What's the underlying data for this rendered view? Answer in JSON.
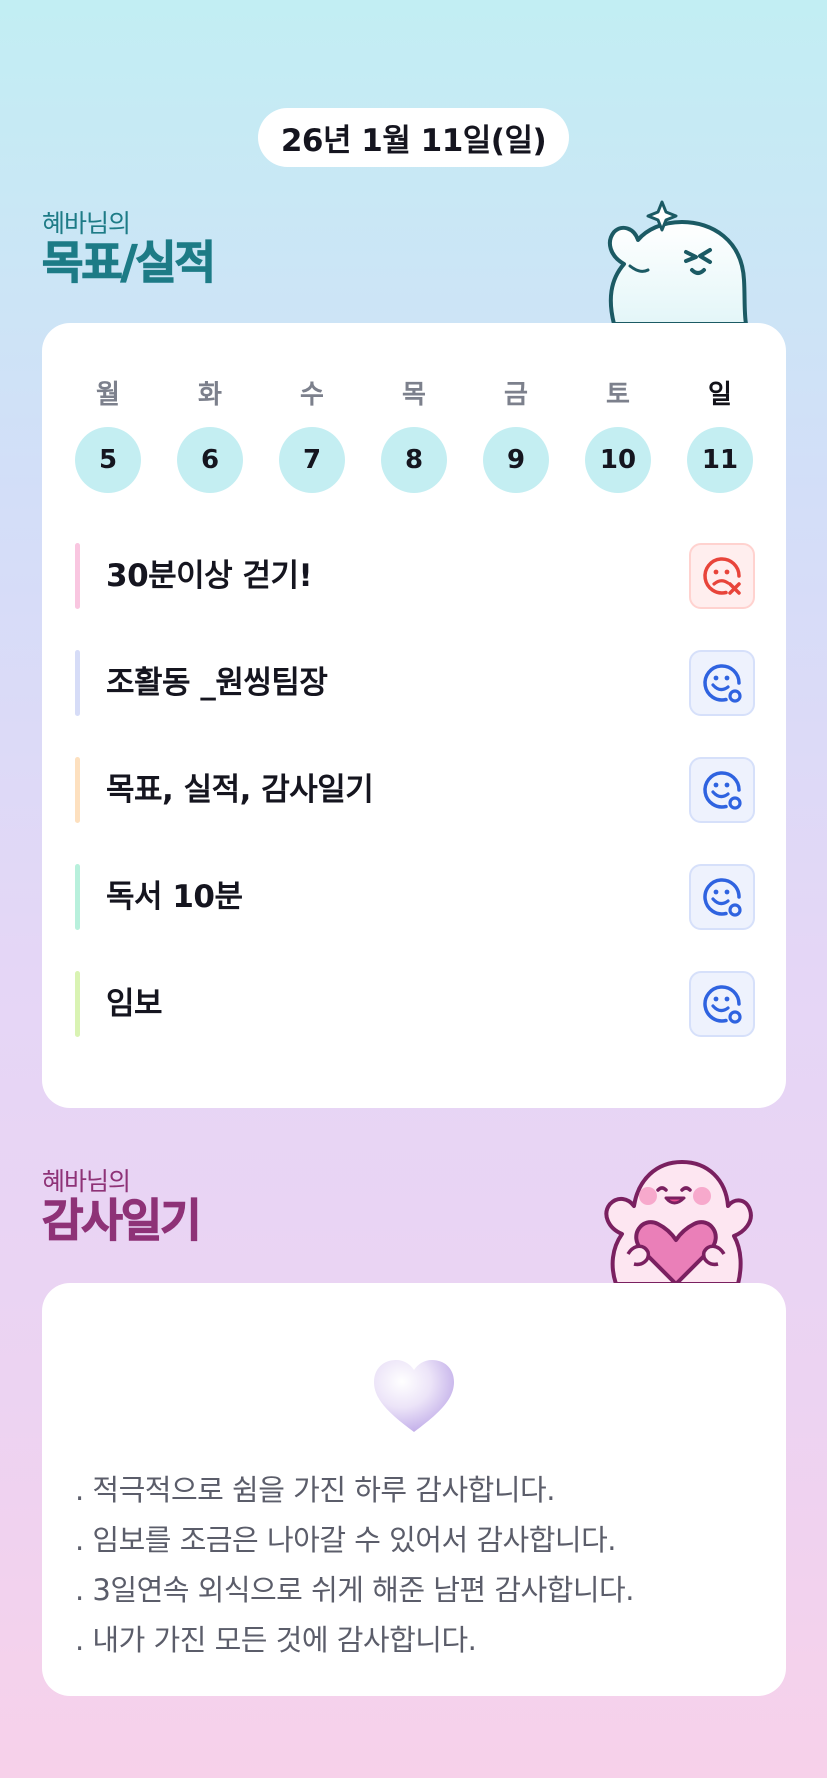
{
  "date_label": "26년 1월 11일(일)",
  "goals_section": {
    "subtitle": "혜바님의",
    "title": "목표/실적",
    "accent_color": "#1d7b86"
  },
  "week": {
    "days": [
      {
        "name": "월",
        "date": "5"
      },
      {
        "name": "화",
        "date": "6"
      },
      {
        "name": "수",
        "date": "7"
      },
      {
        "name": "목",
        "date": "8"
      },
      {
        "name": "금",
        "date": "9"
      },
      {
        "name": "토",
        "date": "10"
      },
      {
        "name": "일",
        "date": "11"
      }
    ],
    "selected_day": "일"
  },
  "goals": [
    {
      "label": "30분이상 걷기!",
      "bar_color": "#f9c6e0",
      "status": "failed",
      "status_icon": "sad-face-x-icon"
    },
    {
      "label": "조활동 _원씽팀장",
      "bar_color": "#d6dcf7",
      "status": "done",
      "status_icon": "smile-face-check-icon"
    },
    {
      "label": "목표, 실적, 감사일기",
      "bar_color": "#fde0bf",
      "status": "done",
      "status_icon": "smile-face-check-icon"
    },
    {
      "label": "독서 10분",
      "bar_color": "#b8f0dc",
      "status": "done",
      "status_icon": "smile-face-check-icon"
    },
    {
      "label": "임보",
      "bar_color": "#d9f3b3",
      "status": "done",
      "status_icon": "smile-face-check-icon"
    }
  ],
  "gratitude_section": {
    "subtitle": "혜바님의",
    "title": "감사일기",
    "accent_color": "#8e3277"
  },
  "gratitude_lines": [
    ". 적극적으로 쉼을 가진 하루 감사합니다.",
    ". 임보를 조금은 나아갈 수 있어서 감사합니다.",
    ". 3일연속 외식으로 쉬게 해준 남편 감사합니다.",
    ". 내가 가진 모든 것에 감사합니다."
  ],
  "colors": {
    "fail": "#e8443a",
    "ok": "#2f63e0",
    "date_circle": "#c4eef2"
  }
}
